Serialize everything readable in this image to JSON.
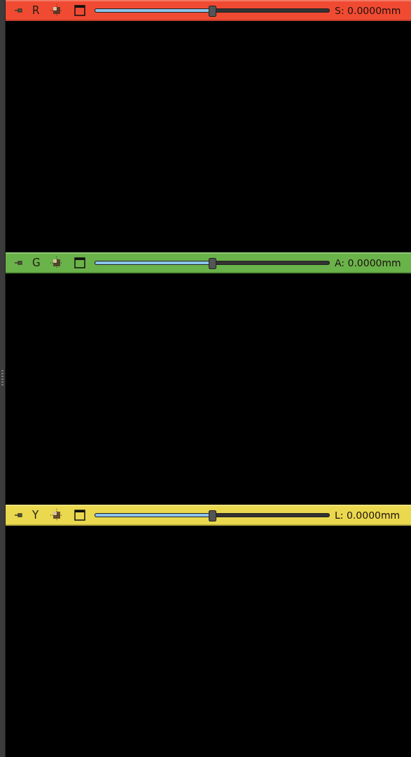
{
  "panels": [
    {
      "channel": "R",
      "color": "#f04b32",
      "level": 0.5,
      "reading": "S: 0.0000mm"
    },
    {
      "channel": "G",
      "color": "#6ab34a",
      "level": 0.5,
      "reading": "A: 0.0000mm"
    },
    {
      "channel": "Y",
      "color": "#ead84e",
      "level": 0.5,
      "reading": "L: 0.0000mm"
    }
  ]
}
